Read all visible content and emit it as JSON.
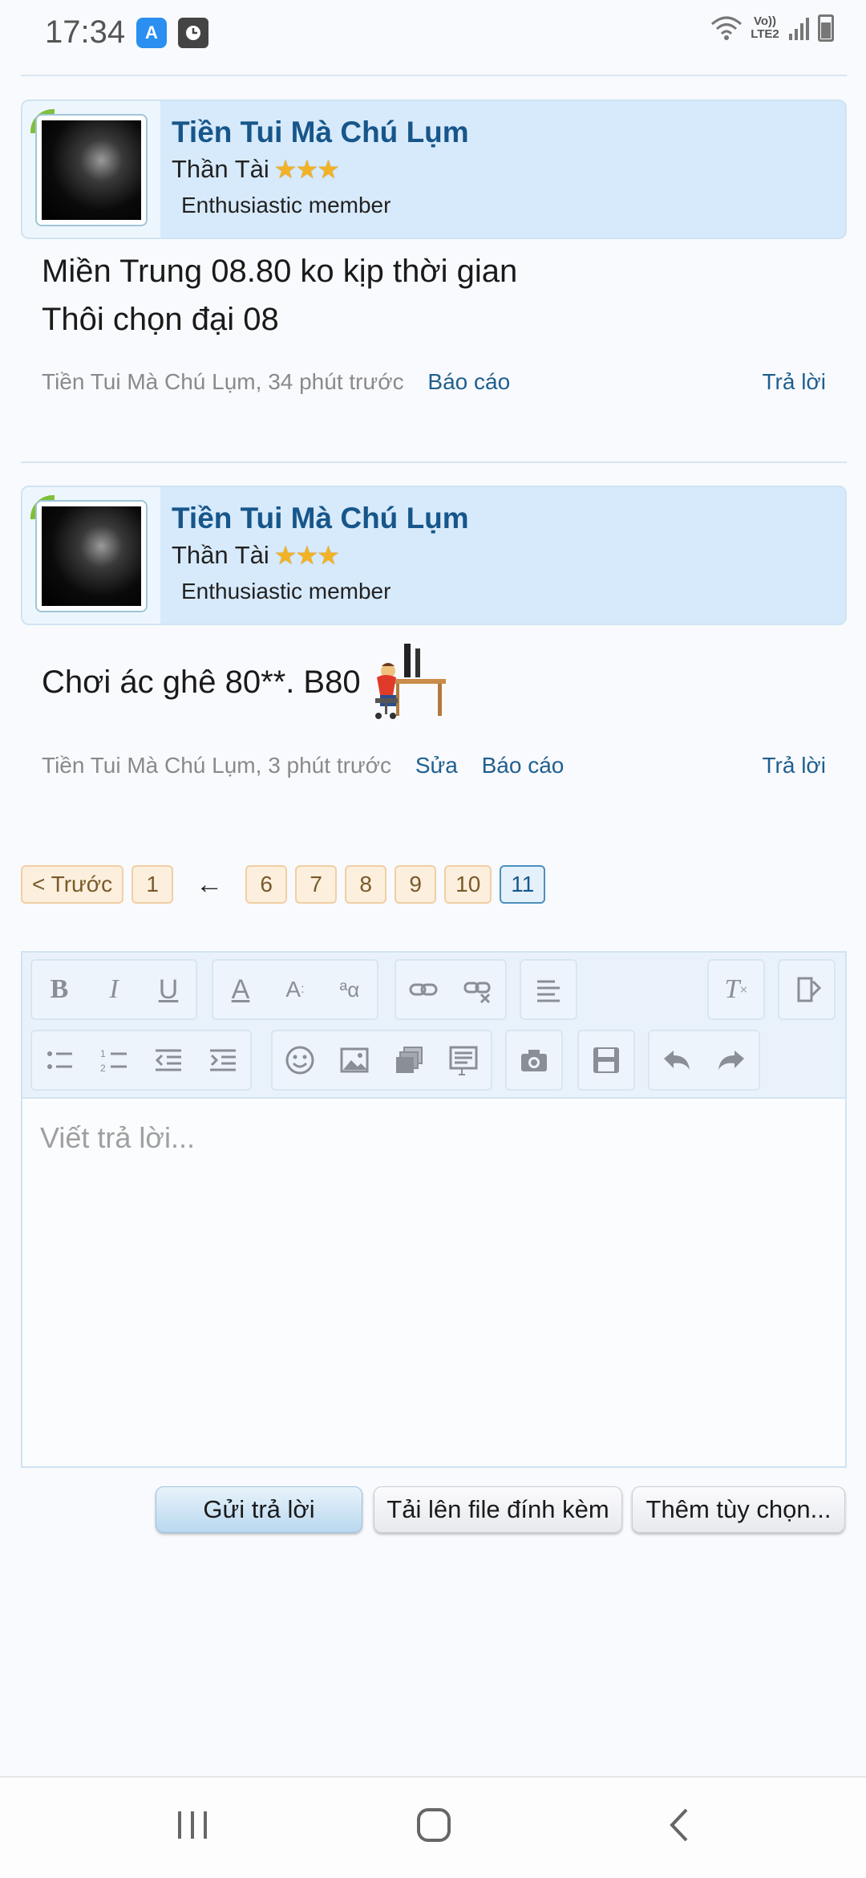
{
  "status_bar": {
    "time": "17:34",
    "volte_label": "Vo)) LTE2",
    "app_icon_1": "rocket-app-icon",
    "app_icon_2": "clock-app-icon"
  },
  "posts": [
    {
      "username": "Tiền Tui Mà Chú Lụm",
      "user_title": "Thần Tài",
      "stars": "★★★",
      "rank": "Enthusiastic member",
      "message_lines": [
        "Miền Trung 08.80 ko kịp thời gian",
        "Thôi chọn đại 08"
      ],
      "meta_author_time": "Tiền Tui Mà Chú Lụm, 34 phút trước",
      "report_label": "Báo cáo",
      "reply_label": "Trả lời"
    },
    {
      "username": "Tiền Tui Mà Chú Lụm",
      "user_title": "Thần Tài",
      "stars": "★★★",
      "rank": "Enthusiastic member",
      "message": "Chơi ác ghê 80**. B80",
      "meta_author_time": "Tiền Tui Mà Chú Lụm, 3 phút trước",
      "edit_label": "Sửa",
      "report_label": "Báo cáo",
      "reply_label": "Trả lời"
    }
  ],
  "pagination": {
    "prev_label": "< Trước",
    "first": "1",
    "gap_arrow": "←",
    "pages": [
      "6",
      "7",
      "8",
      "9",
      "10"
    ],
    "current": "11"
  },
  "editor": {
    "placeholder": "Viết trả lời...",
    "toolbar_row1": [
      "bold-icon",
      "italic-icon",
      "underline-icon",
      "text-color-icon",
      "font-size-icon",
      "font-family-icon",
      "link-icon",
      "unlink-icon",
      "align-icon",
      "clear-format-icon",
      "bbcode-toggle-icon"
    ],
    "toolbar_row2": [
      "bullet-list-icon",
      "numbered-list-icon",
      "outdent-icon",
      "indent-icon",
      "smilie-icon",
      "image-icon",
      "media-icon",
      "quote-icon",
      "camera-icon",
      "save-draft-icon",
      "undo-icon",
      "redo-icon"
    ]
  },
  "buttons": {
    "submit": "Gửi trả lời",
    "upload": "Tải lên file đính kèm",
    "more_options": "Thêm tùy chọn..."
  },
  "colors": {
    "link": "#1f5f8f",
    "username": "#17568a",
    "user_block_bg": "#d7eafb",
    "page_bg": "#f9fafd"
  }
}
